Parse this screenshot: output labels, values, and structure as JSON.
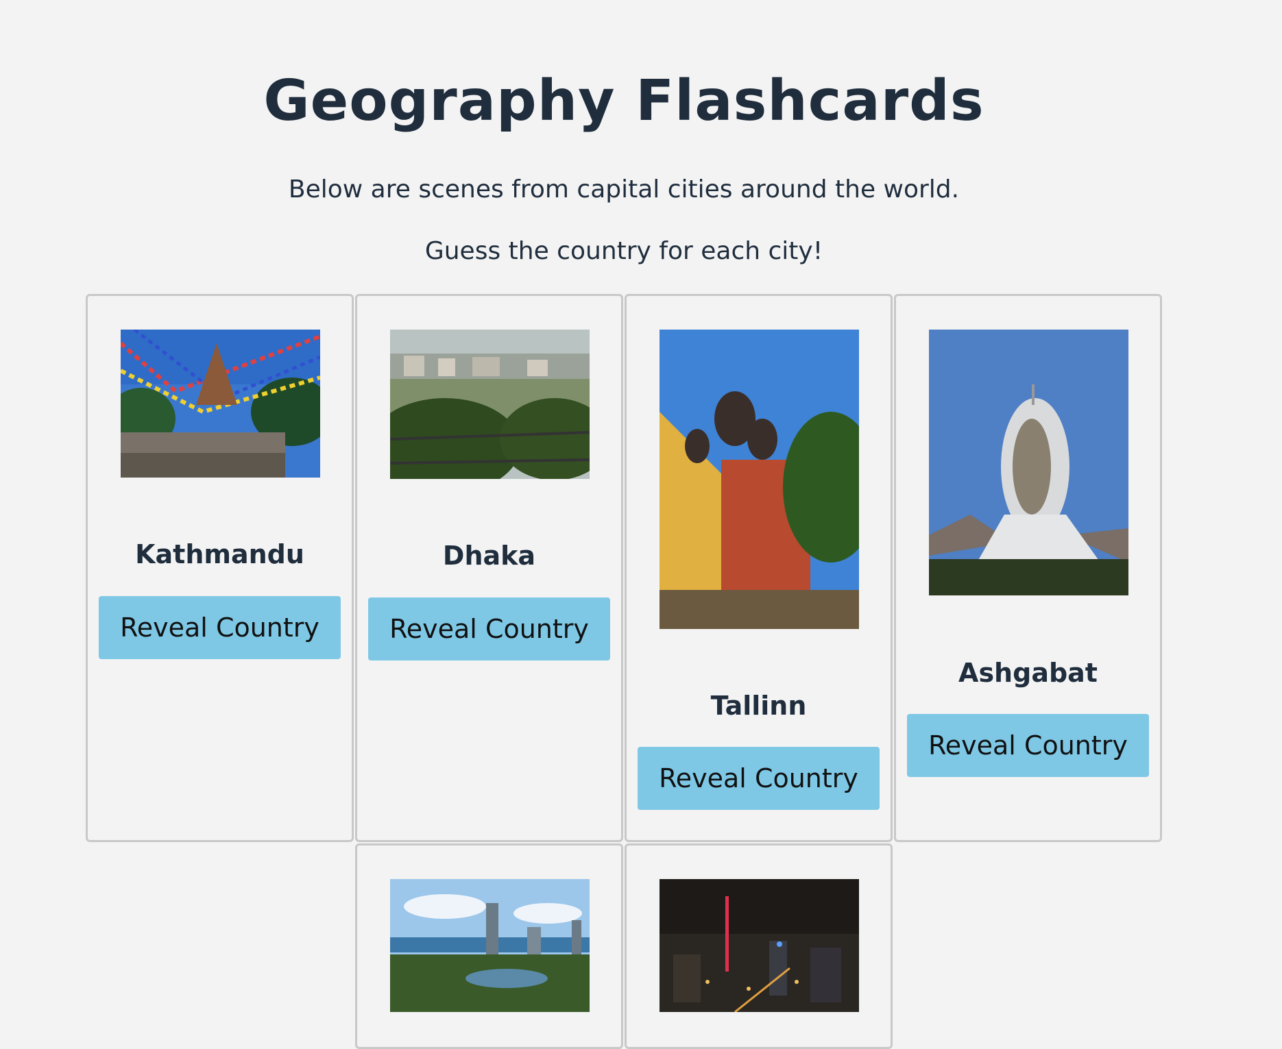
{
  "page": {
    "title": "Geography Flashcards",
    "intro_line1": "Below are scenes from capital cities around the world.",
    "intro_line2": "Guess the country for each city!"
  },
  "cards": [
    {
      "city": "Kathmandu",
      "button": "Reveal Country",
      "photo": "stupa-prayer-flags-photo"
    },
    {
      "city": "Dhaka",
      "button": "Reveal Country",
      "photo": "lake-cityscape-photo"
    },
    {
      "city": "Tallinn",
      "button": "Reveal Country",
      "photo": "orthodox-cathedral-photo"
    },
    {
      "city": "Ashgabat",
      "button": "Reveal Country",
      "photo": "ferris-wheel-building-photo"
    },
    {
      "city": "",
      "button": "",
      "photo": "lake-skyscrapers-photo"
    },
    {
      "city": "",
      "button": "",
      "photo": "night-city-tower-photo"
    }
  ],
  "colors": {
    "background": "#f3f3f3",
    "text": "#1f2d3d",
    "button": "#7ec8e6",
    "card_border": "#c8c8c8"
  }
}
